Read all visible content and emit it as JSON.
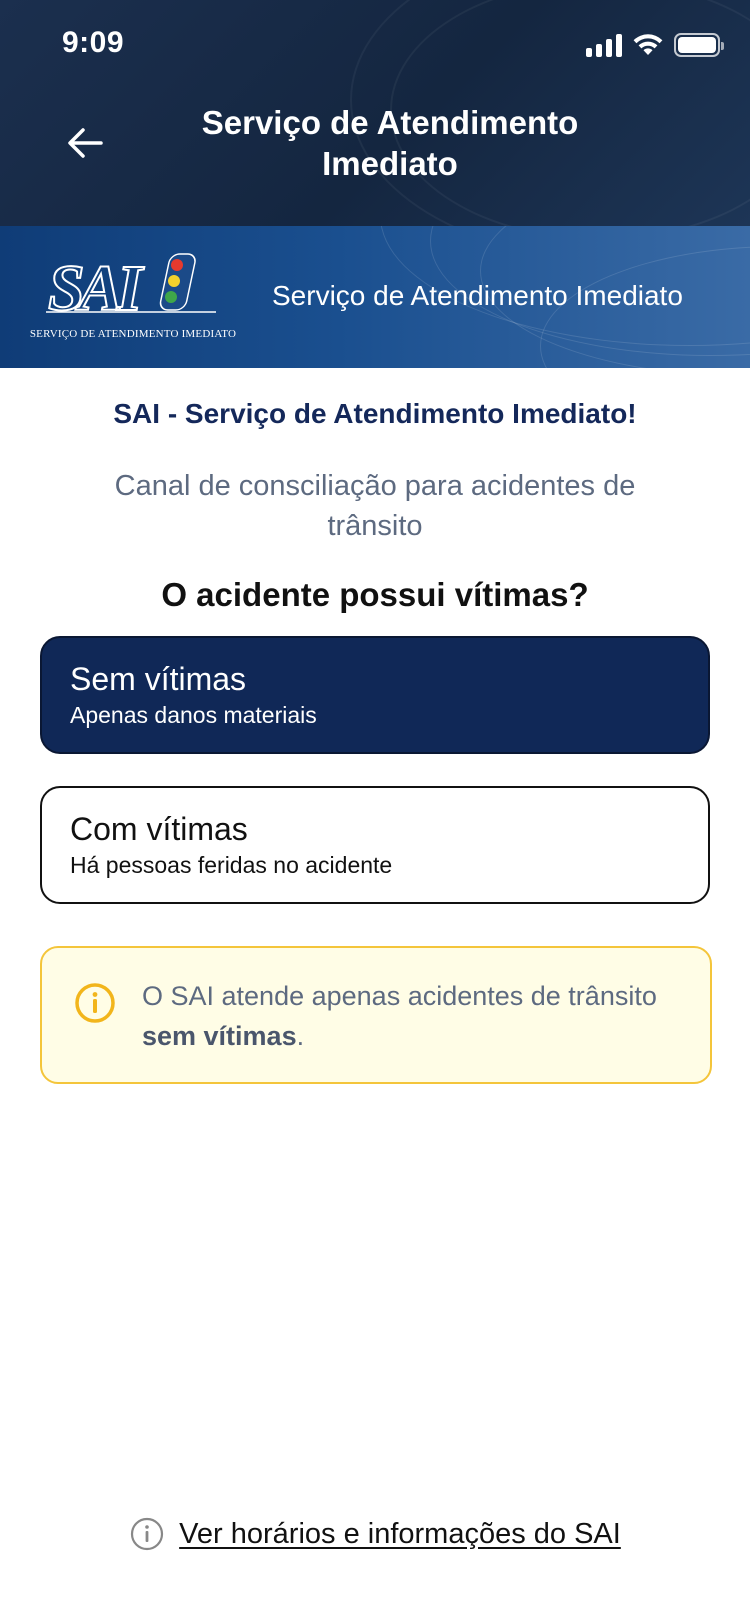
{
  "status_bar": {
    "time": "9:09"
  },
  "header": {
    "title": "Serviço de Atendimento Imediato",
    "back_icon": "arrow-left-icon"
  },
  "banner": {
    "logo_text": "SAI",
    "logo_caption": "SERVIÇO DE ATENDIMENTO IMEDIATO",
    "title": "Serviço de Atendimento Imediato"
  },
  "main": {
    "heading": "SAI - Serviço de Atendimento Imediato!",
    "subtitle": "Canal de consciliação para acidentes de trânsito",
    "question": "O acidente possui vítimas?",
    "options": [
      {
        "title": "Sem vítimas",
        "description": "Apenas danos materiais",
        "selected": true
      },
      {
        "title": "Com vítimas",
        "description": "Há pessoas feridas no acidente",
        "selected": false
      }
    ],
    "notice": {
      "icon": "info-icon",
      "text_before": "O SAI atende apenas acidentes de trânsito ",
      "text_bold": "sem vítimas",
      "text_after": "."
    }
  },
  "footer": {
    "link_text": "Ver horários e informações do SAI",
    "icon": "info-outline-icon"
  },
  "colors": {
    "header_bg": "#1b2f4e",
    "primary_dark": "#102857",
    "heading_blue": "#14285a",
    "notice_bg": "#fffde6",
    "notice_border": "#f4c53a",
    "muted_text": "#5d6a80"
  }
}
